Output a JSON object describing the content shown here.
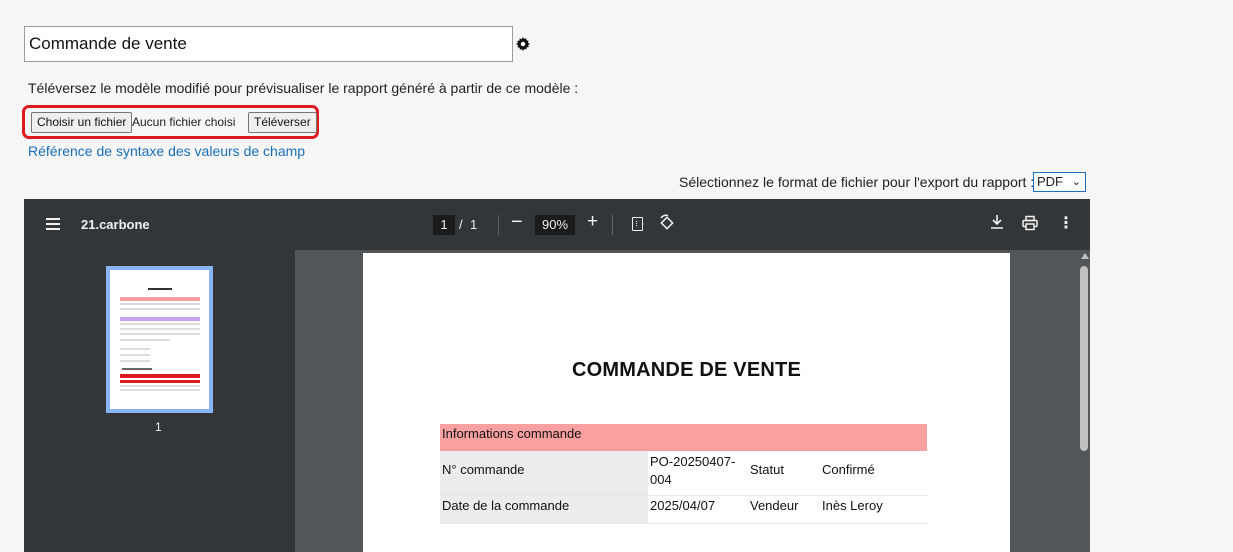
{
  "form": {
    "title_value": "Commande de vente",
    "settings_icon": "gear-icon",
    "instruction": "Téléversez le modèle modifié pour prévisualiser le rapport généré à partir de ce modèle :",
    "choose_file_label": "Choisir un fichier",
    "no_file_text": "Aucun fichier choisi",
    "upload_label": "Téléverser",
    "syntax_link": "Référence de syntaxe des valeurs de champ",
    "format_label": "Sélectionnez le format de fichier pour l'export du rapport :",
    "format_selected": "PDF",
    "highlight_color": "#e0191f",
    "link_color": "#1a6fbf"
  },
  "viewer": {
    "doc_name": "21.carbone",
    "current_page": "1",
    "page_separator": "/",
    "total_pages": "1",
    "zoom": "90%",
    "zoom_out": "−",
    "zoom_in": "+",
    "icons": [
      "menu-icon",
      "fit-page-icon",
      "rotate-icon",
      "download-icon",
      "print-icon",
      "more-icon"
    ],
    "thumbnail_label": "1"
  },
  "document": {
    "title": "COMMANDE DE VENTE",
    "section": "Informations commande",
    "section_color": "#f9a0a0",
    "rows": [
      {
        "label": "N° commande",
        "value": "PO-20250407-004",
        "label2": "Statut",
        "value2": "Confirmé"
      },
      {
        "label": "Date de la commande",
        "value": "2025/04/07",
        "label2": "Vendeur",
        "value2": "Inès Leroy"
      }
    ]
  }
}
